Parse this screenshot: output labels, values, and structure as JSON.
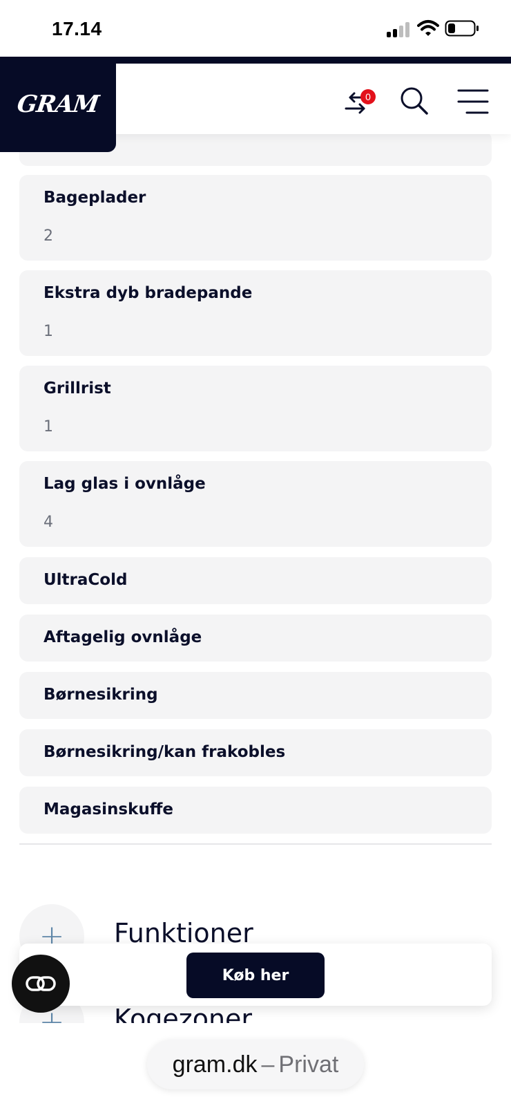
{
  "status_bar": {
    "time": "17.14"
  },
  "header": {
    "logo_text": "GRAM",
    "compare_count": "0"
  },
  "specs": [
    {
      "label": "Bageplader",
      "value": "2"
    },
    {
      "label": "Ekstra dyb bradepande",
      "value": "1"
    },
    {
      "label": "Grillrist",
      "value": "1"
    },
    {
      "label": "Lag glas i ovnlåge",
      "value": "4"
    }
  ],
  "features": [
    {
      "label": "UltraCold"
    },
    {
      "label": "Aftagelig ovnlåge"
    },
    {
      "label": "Børnesikring"
    },
    {
      "label": "Børnesikring/kan frakobles"
    },
    {
      "label": "Magasinskuffe"
    }
  ],
  "sections": [
    {
      "title": "Funktioner"
    },
    {
      "title": "Kogezoner"
    }
  ],
  "buy": {
    "label": "Køb her"
  },
  "browser": {
    "domain": "gram.dk",
    "separator": "–",
    "mode": "Privat"
  },
  "colors": {
    "navy": "#060b26",
    "card": "#f4f4f5",
    "badge": "#e3111b",
    "plus": "#5e86a8"
  }
}
